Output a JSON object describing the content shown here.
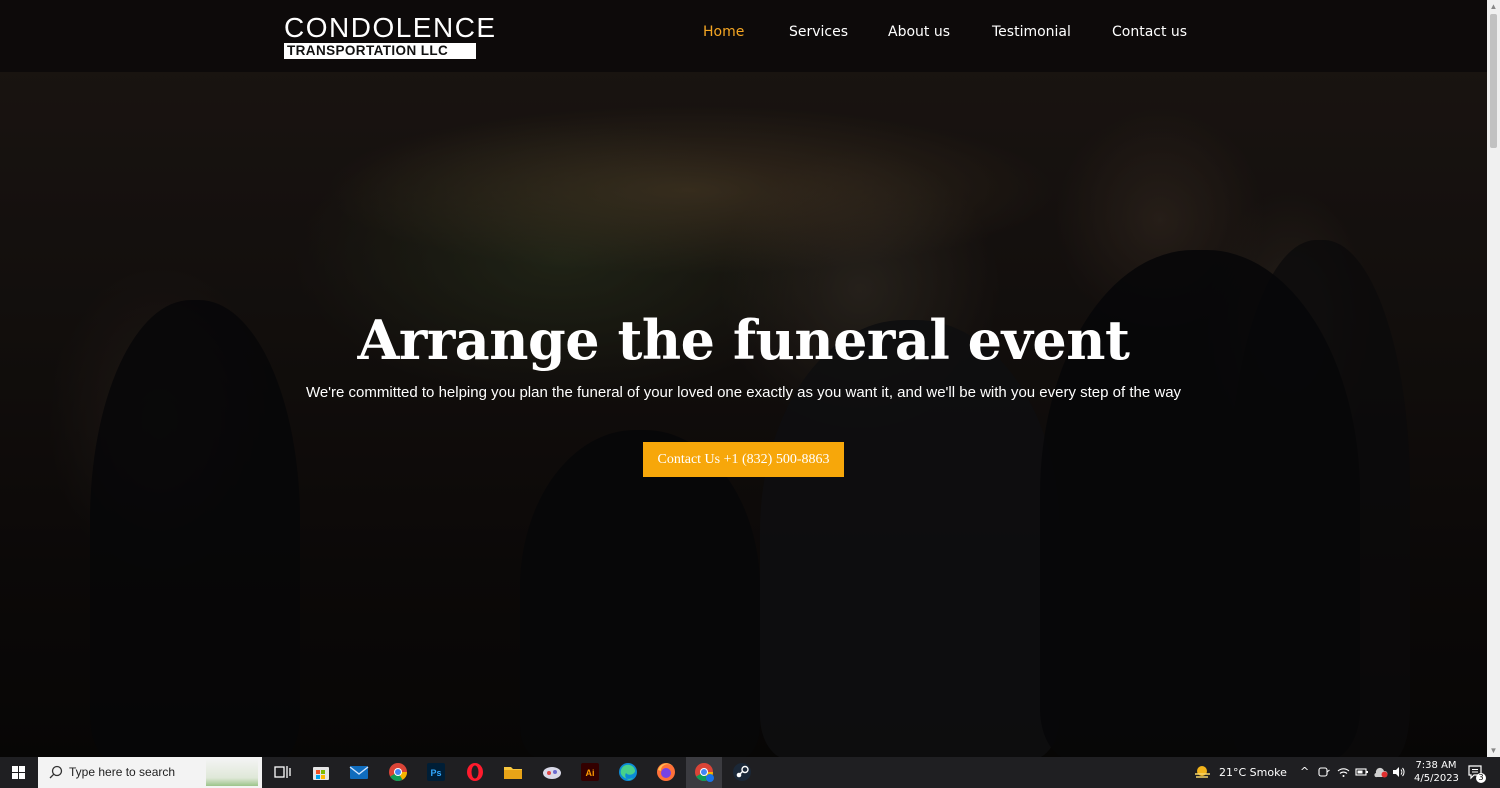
{
  "logo": {
    "line1": "CONDOLENCE",
    "line2": "TRANSPORTATION LLC"
  },
  "nav": {
    "items": [
      {
        "label": "Home",
        "active": true
      },
      {
        "label": "Services",
        "active": false
      },
      {
        "label": "About us",
        "active": false
      },
      {
        "label": "Testimonial",
        "active": false
      },
      {
        "label": "Contact us",
        "active": false
      }
    ]
  },
  "hero": {
    "title": "Arrange the funeral event",
    "subtitle": "We're committed to helping you plan the funeral of your loved one exactly as you want it, and we'll be with you every step of the way",
    "cta_label": "Contact Us +1 (832) 500-8863"
  },
  "colors": {
    "accent": "#f7a70a",
    "nav_active": "#f5a623",
    "nav_bg": "#0c0a0a"
  },
  "taskbar": {
    "search_placeholder": "Type here to search",
    "apps": [
      "task-view-icon",
      "microsoft-store-icon",
      "mail-icon",
      "chrome-icon",
      "photoshop-icon",
      "opera-icon",
      "file-explorer-icon",
      "game-app-icon",
      "illustrator-icon",
      "edge-icon",
      "firefox-icon",
      "chrome-profile-icon",
      "steam-icon"
    ],
    "weather": "21°C  Smoke",
    "time": "7:38 AM",
    "date": "4/5/2023",
    "notification_count": "3"
  }
}
